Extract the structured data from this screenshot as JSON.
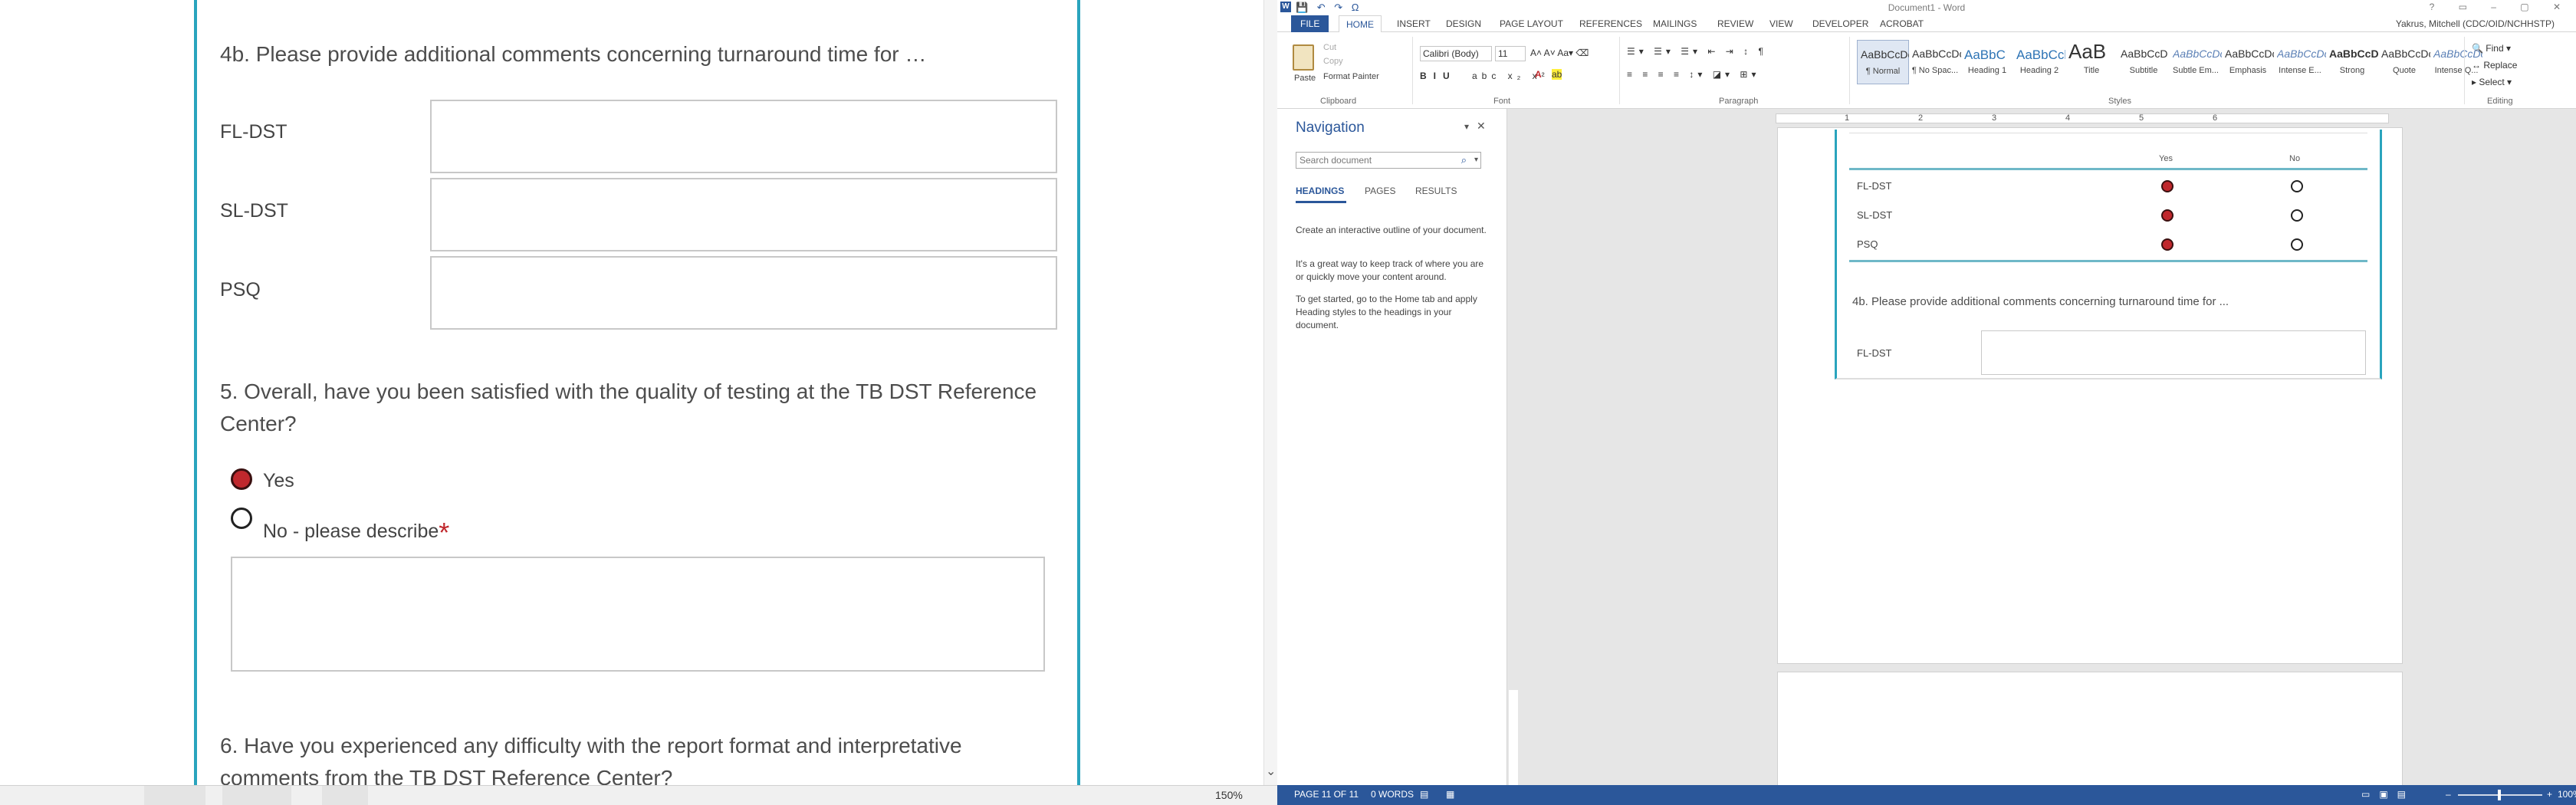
{
  "left": {
    "question_4b": "4b. Please provide additional comments concerning turnaround time for …",
    "rows": [
      {
        "label": "FL-DST"
      },
      {
        "label": "SL-DST"
      },
      {
        "label": "PSQ"
      }
    ],
    "question_5": "5. Overall, have you been satisfied with the quality of testing at the TB DST Reference Center?",
    "options": [
      {
        "label": "Yes",
        "selected": true
      },
      {
        "label": "No - please describe",
        "selected": false,
        "required_mark": "*"
      }
    ],
    "question_6": "6. Have you experienced any difficulty with the report format and interpretative comments from the TB DST Reference Center?",
    "zoom": "150%"
  },
  "word": {
    "title": "Document1 - Word",
    "quick_access": "💾 ↶ ↷ Ω",
    "tabs": [
      "FILE",
      "HOME",
      "INSERT",
      "DESIGN",
      "PAGE LAYOUT",
      "REFERENCES",
      "MAILINGS",
      "REVIEW",
      "VIEW",
      "DEVELOPER",
      "ACROBAT"
    ],
    "active_tab": "HOME",
    "user": "Yakrus, Mitchell (CDC/OID/NCHHSTP)",
    "clipboard": {
      "paste": "Paste",
      "cut": "Cut",
      "copy": "Copy",
      "format_painter": "Format Painter",
      "group": "Clipboard"
    },
    "font": {
      "family": "Calibri (Body)",
      "size": "11",
      "group": "Font"
    },
    "paragraph_group": "Paragraph",
    "styles_group": "Styles",
    "styles": [
      {
        "sample": "AaBbCcDc",
        "name": "¶ Normal"
      },
      {
        "sample": "AaBbCcDc",
        "name": "¶ No Spac..."
      },
      {
        "sample": "AaBbC",
        "name": "Heading 1"
      },
      {
        "sample": "AaBbCcl",
        "name": "Heading 2"
      },
      {
        "sample": "AaB",
        "name": "Title"
      },
      {
        "sample": "AaBbCcD",
        "name": "Subtitle"
      },
      {
        "sample": "AaBbCcDc",
        "name": "Subtle Em..."
      },
      {
        "sample": "AaBbCcDc",
        "name": "Emphasis"
      },
      {
        "sample": "AaBbCcDc",
        "name": "Intense E..."
      },
      {
        "sample": "AaBbCcDc",
        "name": "Strong"
      },
      {
        "sample": "AaBbCcDc",
        "name": "Quote"
      },
      {
        "sample": "AaBbCcDc",
        "name": "Intense Q..."
      }
    ],
    "editing": {
      "find": "Find",
      "replace": "Replace",
      "select": "Select",
      "group": "Editing"
    },
    "navigation": {
      "title": "Navigation",
      "search_placeholder": "Search document",
      "tabs": [
        "HEADINGS",
        "PAGES",
        "RESULTS"
      ],
      "help": [
        "Create an interactive outline of your document.",
        "It's a great way to keep track of where you are or quickly move your content around.",
        "To get started, go to the Home tab and apply Heading styles to the headings in your document."
      ]
    },
    "ruler_numbers": [
      "1",
      "2",
      "3",
      "4",
      "5",
      "6"
    ],
    "embedded": {
      "col_yes": "Yes",
      "col_no": "No",
      "rows": [
        {
          "label": "FL-DST",
          "yes": true
        },
        {
          "label": "SL-DST",
          "yes": true
        },
        {
          "label": "PSQ",
          "yes": true
        }
      ],
      "question_4b": "4b. Please provide additional comments concerning turnaround time for ...",
      "fl_label": "FL-DST"
    },
    "status": {
      "page": "PAGE 11 OF 11",
      "words": "0 WORDS",
      "zoom": "100%"
    }
  }
}
